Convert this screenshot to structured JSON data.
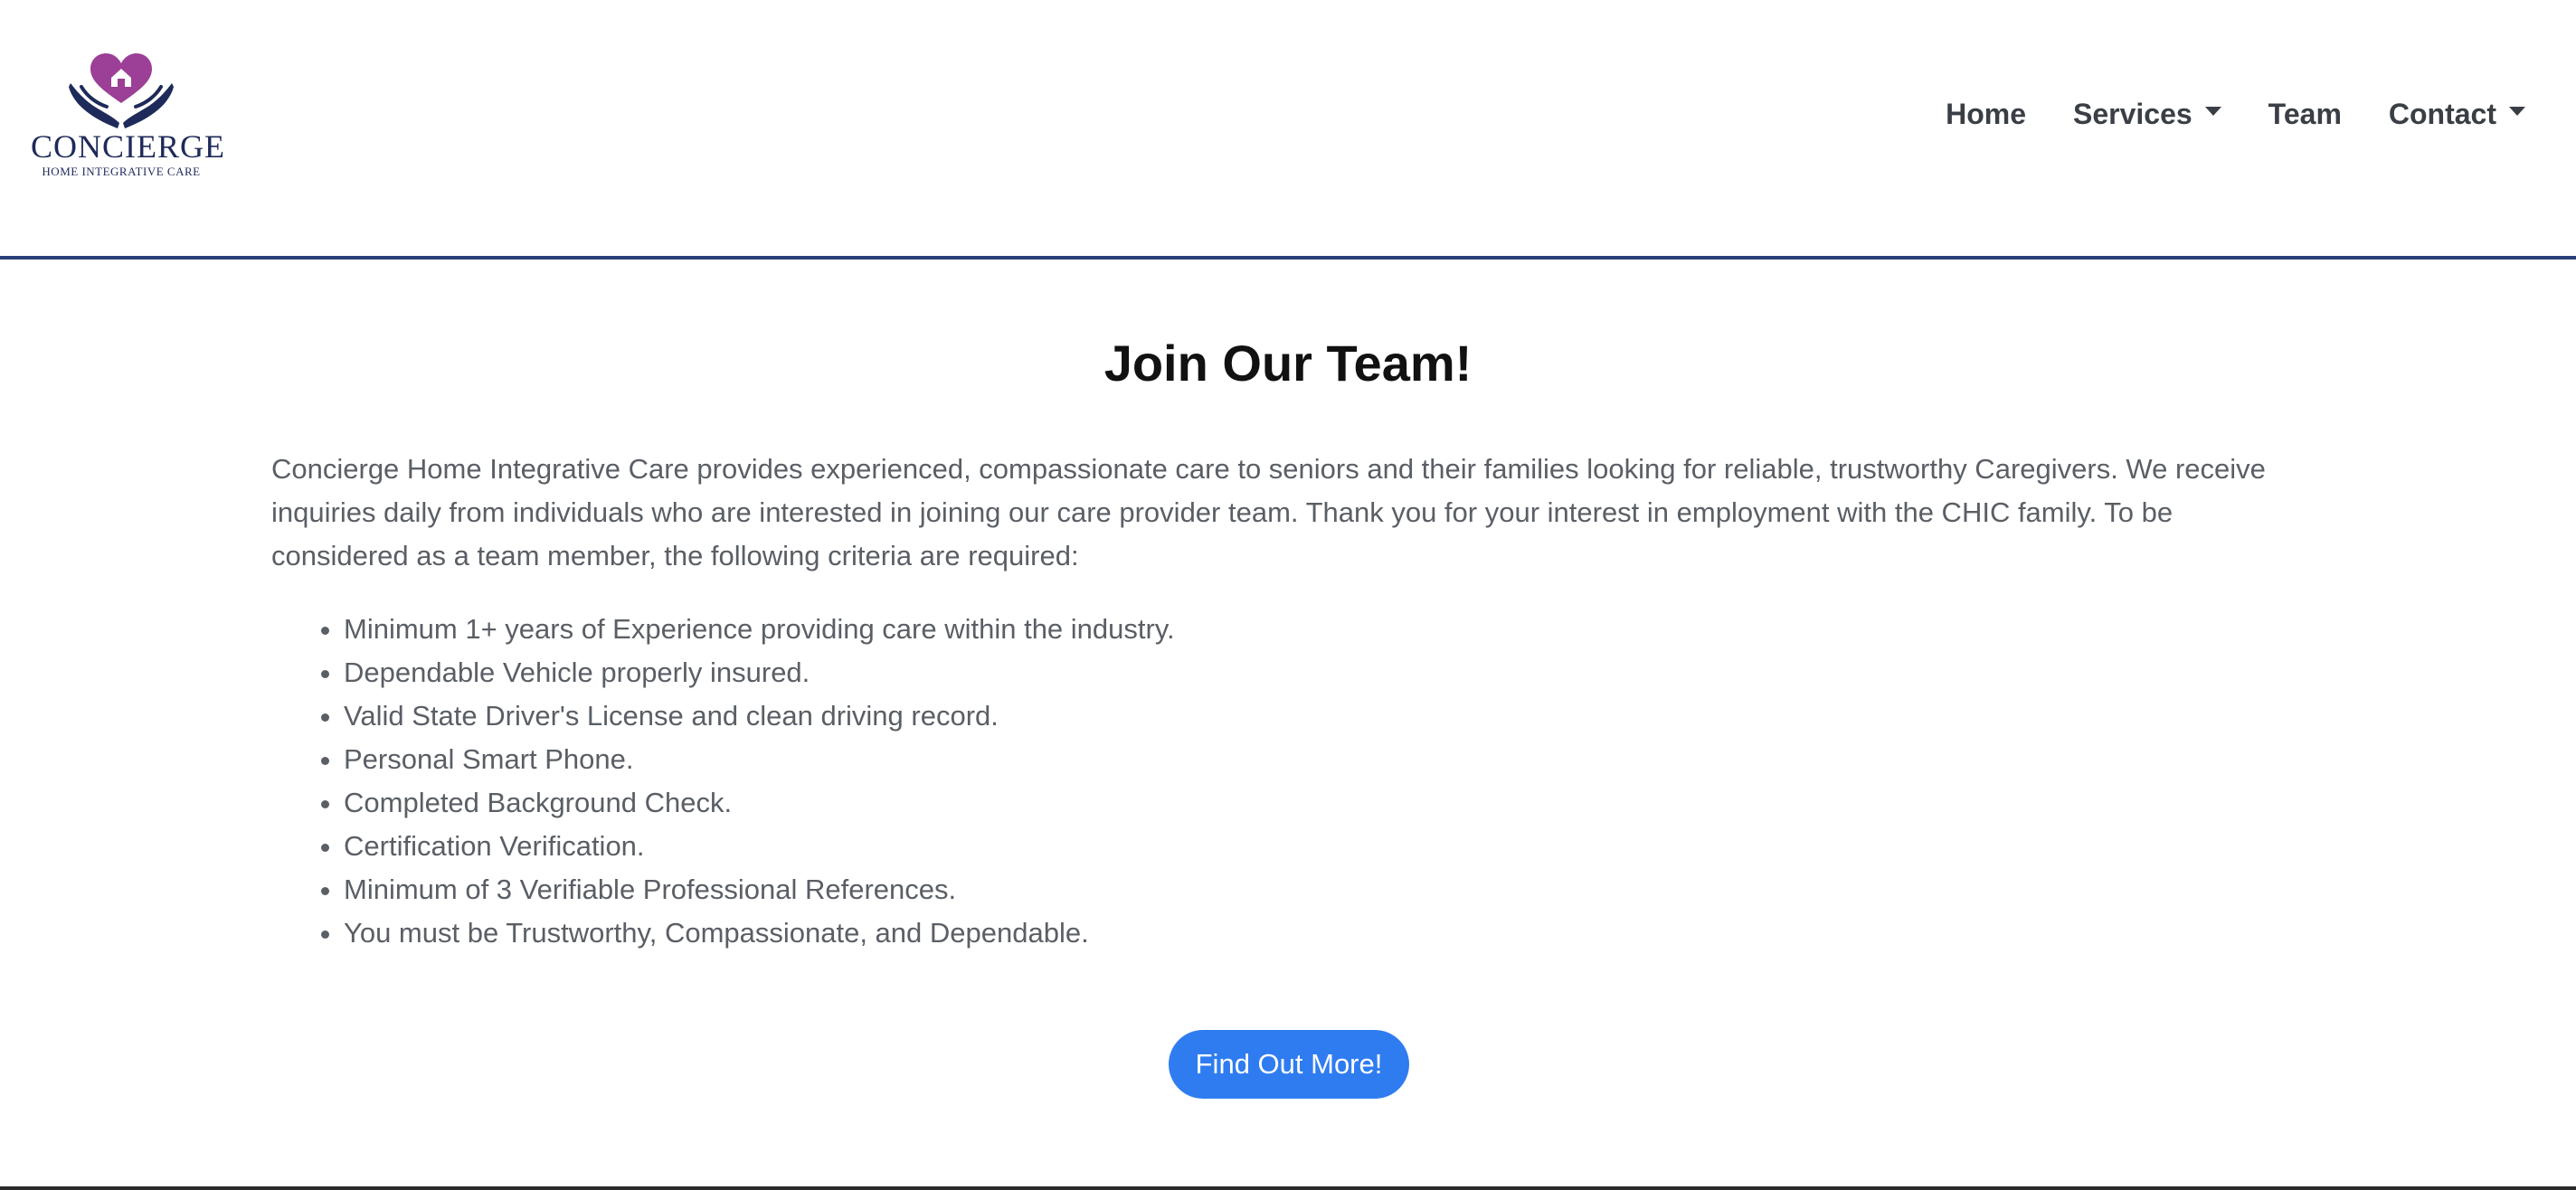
{
  "brand": {
    "name": "CONCIERGE",
    "tagline": "HOME INTEGRATIVE CARE",
    "logo_icon": "heart-house-hands-icon",
    "colors": {
      "heart": "#9b3f97",
      "hands": "#1e2a5a"
    }
  },
  "nav": {
    "items": [
      {
        "label": "Home",
        "dropdown": false
      },
      {
        "label": "Services",
        "dropdown": true
      },
      {
        "label": "Team",
        "dropdown": false
      },
      {
        "label": "Contact",
        "dropdown": true
      }
    ]
  },
  "main": {
    "title": "Join Our Team!",
    "intro": "Concierge Home Integrative Care provides experienced, compassionate care to seniors and their families looking for reliable, trustworthy Caregivers. We receive inquiries daily from individuals who are interested in joining our care provider team. Thank you for your interest in employment with the CHIC family. To be considered as a team member, the following criteria are required:",
    "criteria": [
      "Minimum 1+ years of Experience providing care within the industry.",
      "Dependable Vehicle properly insured.",
      "Valid State Driver's License and clean driving record.",
      "Personal Smart Phone.",
      "Completed Background Check.",
      "Certification Verification.",
      "Minimum of 3 Verifiable Professional References.",
      "You must be Trustworthy, Compassionate, and Dependable."
    ],
    "cta_label": "Find Out More!"
  },
  "theme": {
    "header_border": "#2c3e78",
    "button": "#2f7cf0",
    "body_text": "#5a5f66"
  }
}
